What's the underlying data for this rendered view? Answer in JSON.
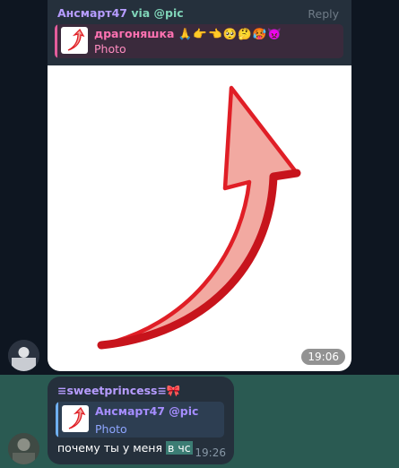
{
  "chat": {
    "messages": [
      {
        "sender": "Ансмарт47",
        "via": "via @pic",
        "reply_button": "Reply",
        "reply": {
          "name": "драгоняшка",
          "emojis": "🙏👉👈🥺🤔🥵👿",
          "text": "Photo"
        },
        "time": "19:06"
      },
      {
        "sender": "≡sweetprincess≡🎀",
        "reply": {
          "name": "Ансмарт47 @pic",
          "text": "Photo"
        },
        "text": "почему ты у меня",
        "highlighted_text": "в чс",
        "time": "19:26"
      }
    ]
  },
  "colors": {
    "background": "#0e1621",
    "bubble": "#25303c",
    "selected_row": "#2a5a52",
    "sender_name": "#b69cff",
    "via": "#7fd4b8",
    "arrow_fill": "#f2a9a1",
    "arrow_edge": "#e01e26"
  }
}
